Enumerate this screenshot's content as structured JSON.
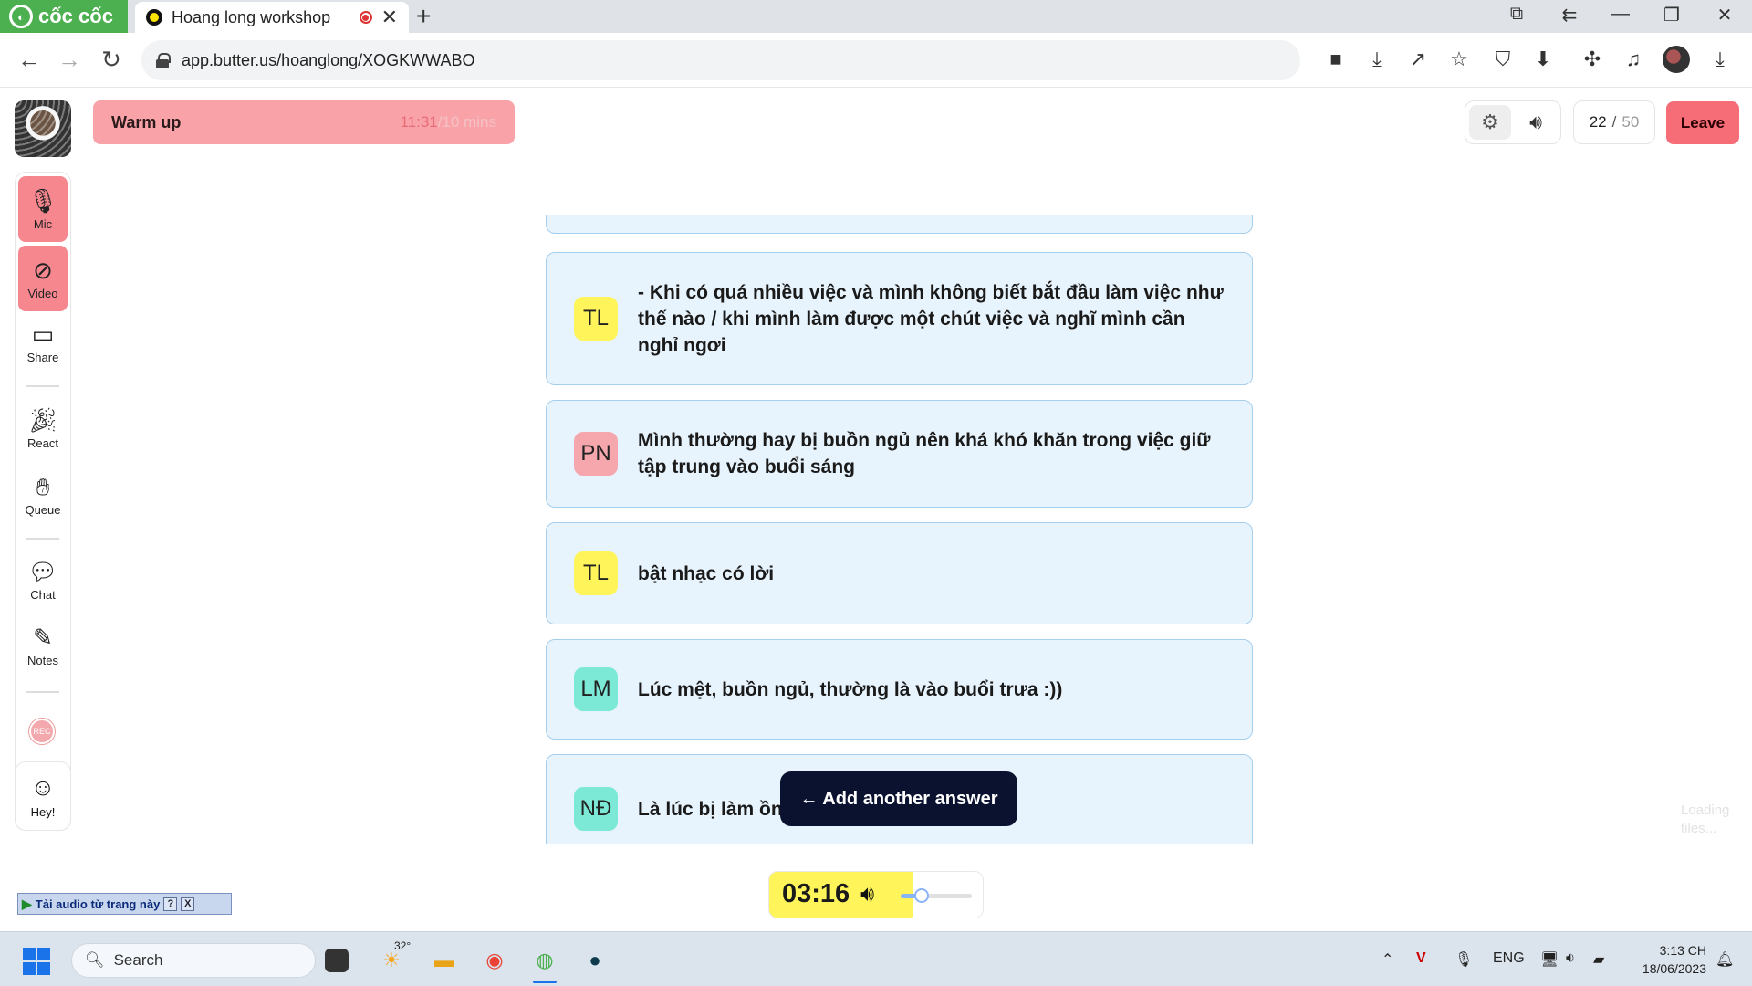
{
  "browser": {
    "brand": "cốc cốc",
    "tab_title": "Hoang long workshop",
    "url": "app.butter.us/hoanglong/XOGKWWABO"
  },
  "session": {
    "phase_name": "Warm up",
    "elapsed": "11:31",
    "total": "/10 mins",
    "counter_current": "22",
    "counter_sep": "/",
    "counter_max": "50",
    "leave_label": "Leave"
  },
  "rail": {
    "mic": "Mic",
    "video": "Video",
    "share": "Share",
    "react": "React",
    "queue": "Queue",
    "chat": "Chat",
    "notes": "Notes",
    "rec": "REC",
    "hey": "Hey!"
  },
  "answers": [
    {
      "initials": "TL",
      "text": "- Khi có quá nhiều việc và mình không biết bắt đầu làm việc như thế nào / khi mình làm được một chút việc và nghĩ mình cần nghỉ ngơi",
      "color": "#fff45a"
    },
    {
      "initials": "PN",
      "text": "Mình thường hay bị buồn ngủ nên khá khó khăn trong việc giữ tập trung vào buổi sáng",
      "color": "#f6a7ae"
    },
    {
      "initials": "TL",
      "text": "bật nhạc có lời",
      "color": "#fff45a"
    },
    {
      "initials": "LM",
      "text": "Lúc mệt, buồn ngủ, thường là vào buổi trưa :))",
      "color": "#7ce8d6"
    },
    {
      "initials": "NĐ",
      "text": "Là lúc bị làm ồn",
      "color": "#7ce8d6"
    }
  ],
  "add_answer_label": "← Add another answer",
  "loading_text": "Loading tiles...",
  "timer": {
    "display": "03:16",
    "progress_fraction": 0.67,
    "volume_fraction": 0.3
  },
  "audio_widget": {
    "label": "Tải audio từ trang này",
    "help": "?",
    "close": "X"
  },
  "taskbar": {
    "search_label": "Search",
    "weather": "32°",
    "language": "ENG",
    "time": "3:13 CH",
    "date": "18/06/2023"
  },
  "colors": {
    "accent_pink": "#f6878f",
    "leave": "#f66c77",
    "card_bg": "#e8f4fd",
    "card_border": "#a6cfee",
    "timer_yellow": "#fff45a"
  }
}
